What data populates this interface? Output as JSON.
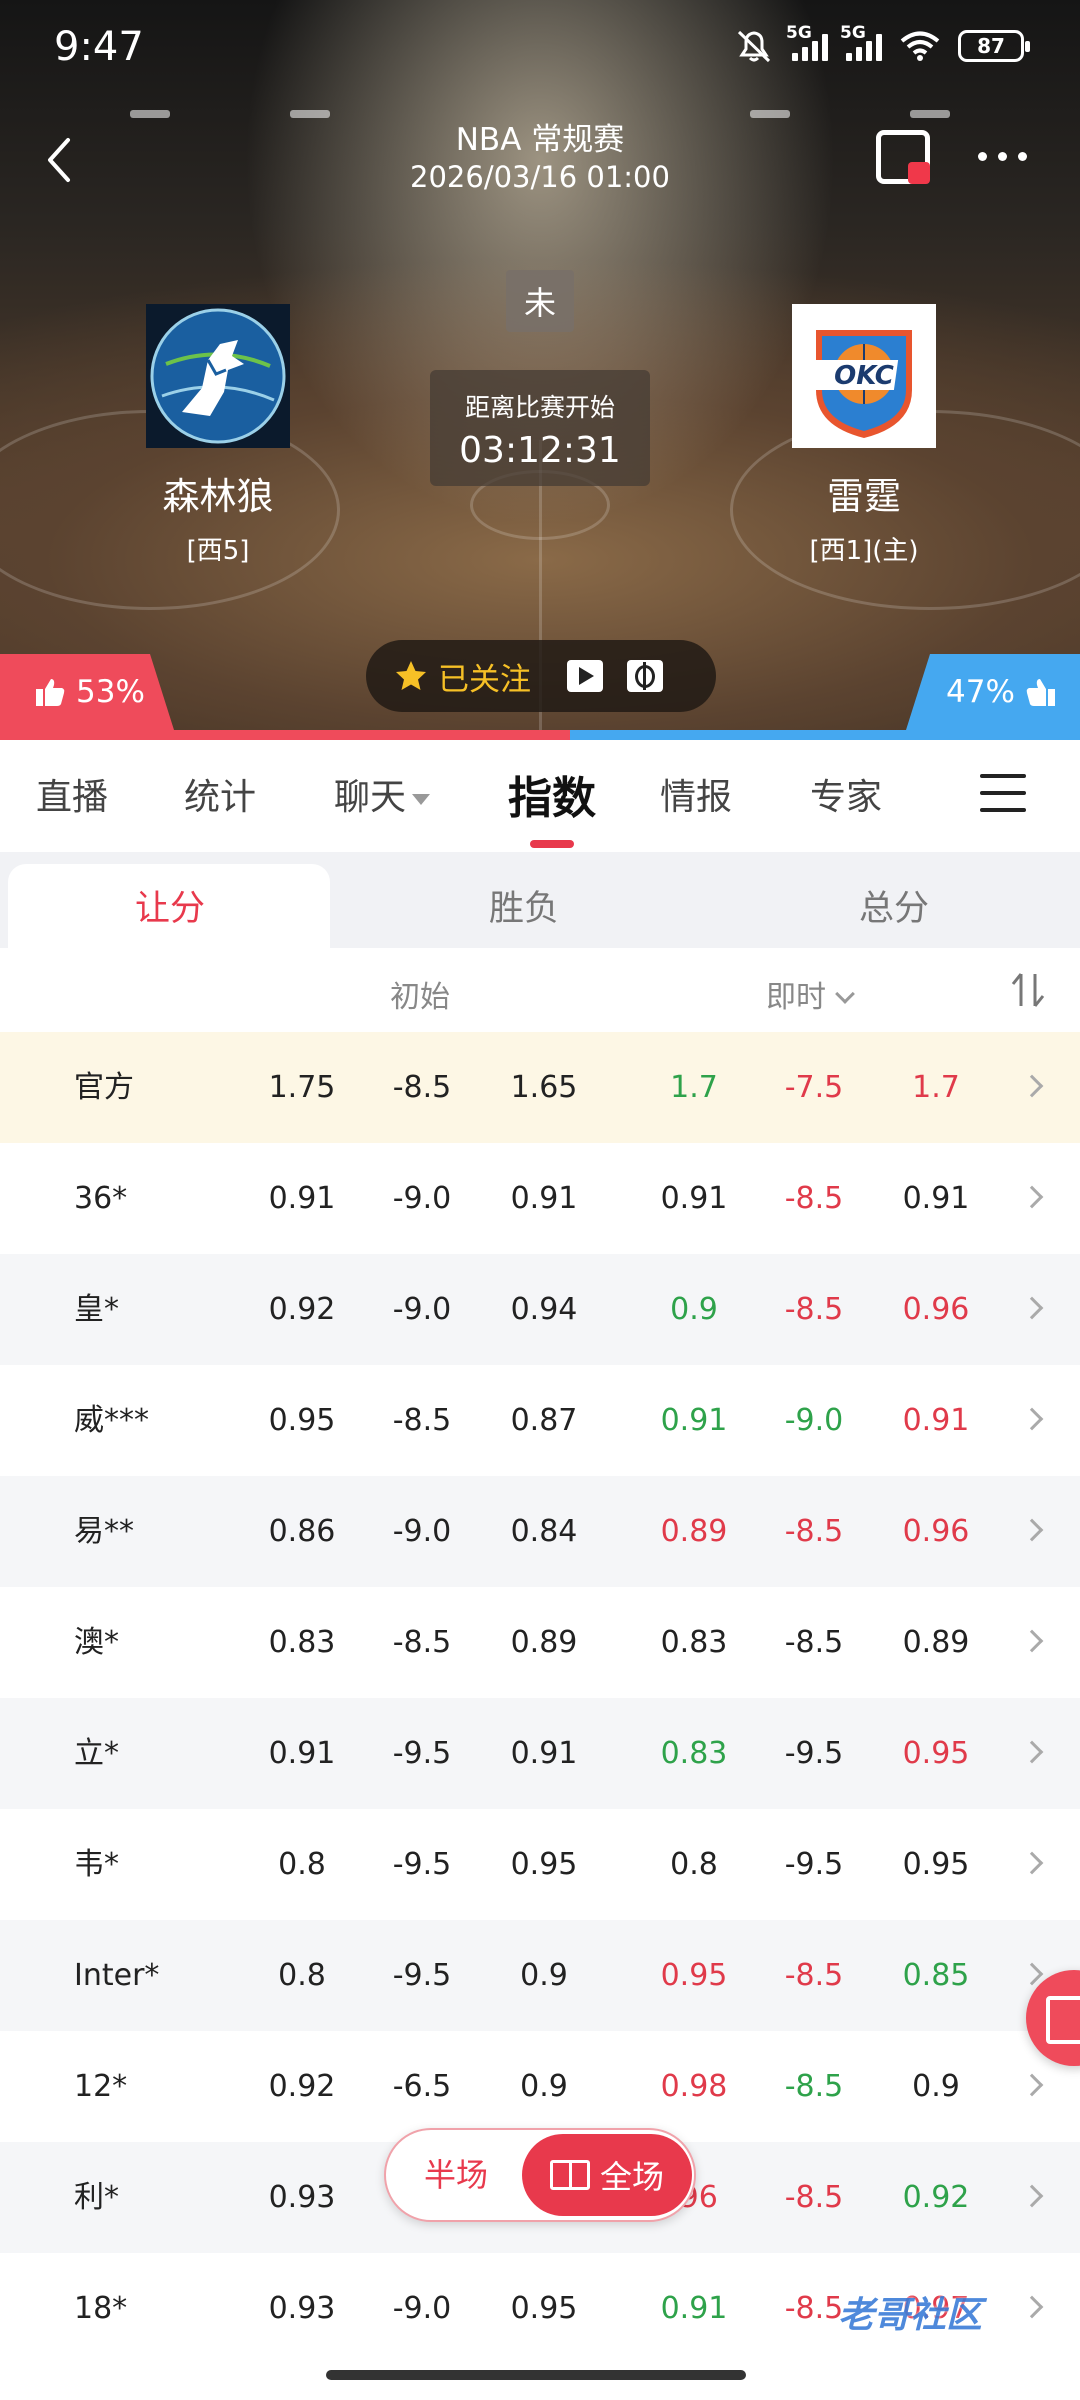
{
  "status_bar": {
    "time": "9:47",
    "net1": "5G",
    "net2": "5G",
    "battery": "87",
    "icons": [
      "mute-bell-icon",
      "signal-icon",
      "signal-icon",
      "wifi-icon",
      "battery-icon"
    ]
  },
  "header": {
    "league": "NBA 常规赛",
    "datetime": "2026/03/16 01:00",
    "state": "未",
    "countdown_label": "距离比赛开始",
    "countdown": "03:12:31"
  },
  "teams": {
    "home_left": {
      "name": "森林狼",
      "rank": "[西5]"
    },
    "away_right": {
      "name": "雷霆",
      "rank": "[西1](主)"
    }
  },
  "follow": {
    "label": "已关注"
  },
  "votes": {
    "left": "53%",
    "right": "47%",
    "left_color": "#ef4b5b",
    "right_color": "#45a8f0"
  },
  "main_tabs": [
    {
      "label": "直播"
    },
    {
      "label": "统计"
    },
    {
      "label": "聊天"
    },
    {
      "label": "指数"
    },
    {
      "label": "情报"
    },
    {
      "label": "专家"
    }
  ],
  "sub_tabs": [
    {
      "label": "让分"
    },
    {
      "label": "胜负"
    },
    {
      "label": "总分"
    }
  ],
  "columns": {
    "initial": "初始",
    "live": "即时"
  },
  "accent_color": "#e8394c",
  "rows": [
    {
      "name": "官方",
      "i1": "1.75",
      "i2": "-8.5",
      "i3": "1.65",
      "l1": "1.7",
      "l2": "-7.5",
      "l3": "1.7",
      "c1": "green",
      "c2": "red",
      "c3": "red"
    },
    {
      "name": "36*",
      "i1": "0.91",
      "i2": "-9.0",
      "i3": "0.91",
      "l1": "0.91",
      "l2": "-8.5",
      "l3": "0.91",
      "c1": "",
      "c2": "red",
      "c3": ""
    },
    {
      "name": "皇*",
      "i1": "0.92",
      "i2": "-9.0",
      "i3": "0.94",
      "l1": "0.9",
      "l2": "-8.5",
      "l3": "0.96",
      "c1": "green",
      "c2": "red",
      "c3": "red"
    },
    {
      "name": "威***",
      "i1": "0.95",
      "i2": "-8.5",
      "i3": "0.87",
      "l1": "0.91",
      "l2": "-9.0",
      "l3": "0.91",
      "c1": "green",
      "c2": "green",
      "c3": "red"
    },
    {
      "name": "易**",
      "i1": "0.86",
      "i2": "-9.0",
      "i3": "0.84",
      "l1": "0.89",
      "l2": "-8.5",
      "l3": "0.96",
      "c1": "red",
      "c2": "red",
      "c3": "red"
    },
    {
      "name": "澳*",
      "i1": "0.83",
      "i2": "-8.5",
      "i3": "0.89",
      "l1": "0.83",
      "l2": "-8.5",
      "l3": "0.89",
      "c1": "",
      "c2": "",
      "c3": ""
    },
    {
      "name": "立*",
      "i1": "0.91",
      "i2": "-9.5",
      "i3": "0.91",
      "l1": "0.83",
      "l2": "-9.5",
      "l3": "0.95",
      "c1": "green",
      "c2": "",
      "c3": "red"
    },
    {
      "name": "韦*",
      "i1": "0.8",
      "i2": "-9.5",
      "i3": "0.95",
      "l1": "0.8",
      "l2": "-9.5",
      "l3": "0.95",
      "c1": "",
      "c2": "",
      "c3": ""
    },
    {
      "name": "Inter*",
      "i1": "0.8",
      "i2": "-9.5",
      "i3": "0.9",
      "l1": "0.95",
      "l2": "-8.5",
      "l3": "0.85",
      "c1": "red",
      "c2": "red",
      "c3": "green"
    },
    {
      "name": "12*",
      "i1": "0.92",
      "i2": "-6.5",
      "i3": "0.9",
      "l1": "0.98",
      "l2": "-8.5",
      "l3": "0.9",
      "c1": "red",
      "c2": "green",
      "c3": ""
    },
    {
      "name": "利*",
      "i1": "0.93",
      "i2": "",
      "i3": "",
      "l1": ".96",
      "l2": "-8.5",
      "l3": "0.92",
      "c1": "red",
      "c2": "red",
      "c3": "green"
    },
    {
      "name": "18*",
      "i1": "0.93",
      "i2": "-9.0",
      "i3": "0.95",
      "l1": "0.91",
      "l2": "-8.5",
      "l3": "0.97",
      "c1": "green",
      "c2": "red",
      "c3": "red"
    }
  ],
  "floating": {
    "half": "半场",
    "full": "全场"
  },
  "watermark": "老哥社区"
}
